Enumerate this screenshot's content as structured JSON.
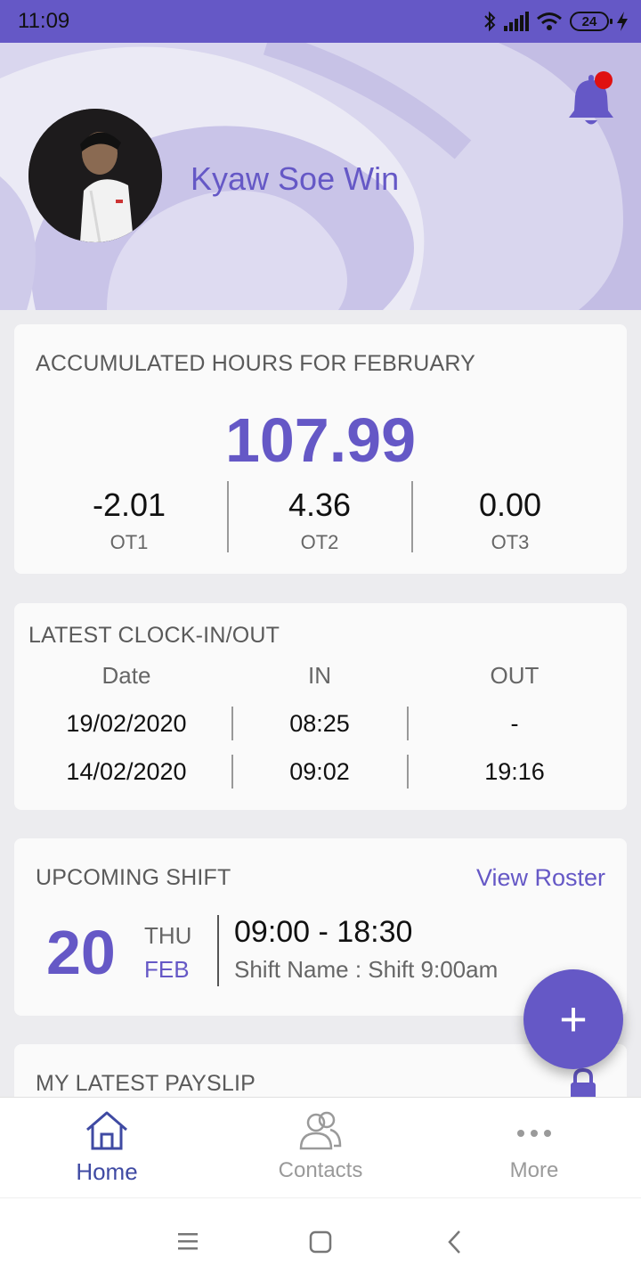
{
  "status_bar": {
    "time": "11:09",
    "battery": "24"
  },
  "profile": {
    "name": "Kyaw Soe Win"
  },
  "hours": {
    "title": "ACCUMULATED HOURS FOR FEBRUARY",
    "total": "107.99",
    "ot": [
      {
        "value": "-2.01",
        "label": "OT1"
      },
      {
        "value": "4.36",
        "label": "OT2"
      },
      {
        "value": "0.00",
        "label": "OT3"
      }
    ]
  },
  "clock": {
    "title": "LATEST CLOCK-IN/OUT",
    "headers": [
      "Date",
      "IN",
      "OUT"
    ],
    "rows": [
      [
        "19/02/2020",
        "08:25",
        "-"
      ],
      [
        "14/02/2020",
        "09:02",
        "19:16"
      ]
    ]
  },
  "shift": {
    "title": "UPCOMING SHIFT",
    "view_roster": "View Roster",
    "day": "20",
    "weekday": "THU",
    "month": "FEB",
    "time": "09:00 - 18:30",
    "name": "Shift Name : Shift 9:00am"
  },
  "payslip": {
    "title": "MY LATEST PAYSLIP"
  },
  "fab": {
    "label": "+"
  },
  "nav": [
    {
      "label": "Home",
      "icon": "home-icon",
      "active": true
    },
    {
      "label": "Contacts",
      "icon": "contacts-icon",
      "active": false
    },
    {
      "label": "More",
      "icon": "more-icon",
      "active": false
    }
  ],
  "colors": {
    "accent": "#6558c6",
    "status_bar": "#6558c6",
    "notification_dot": "#e01010"
  }
}
